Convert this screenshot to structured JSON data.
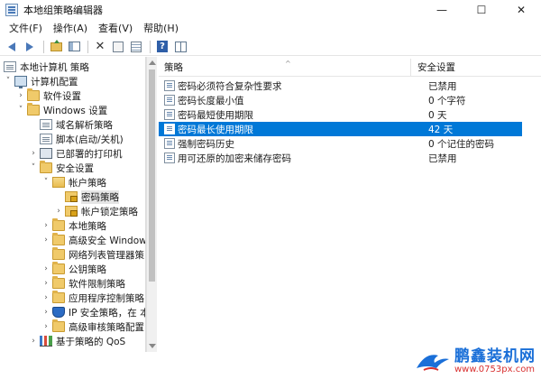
{
  "window": {
    "title": "本地组策略编辑器",
    "controls": {
      "minimize": "—",
      "maximize": "☐",
      "close": "✕"
    }
  },
  "menu": [
    "文件(F)",
    "操作(A)",
    "查看(V)",
    "帮助(H)"
  ],
  "toolbar": {
    "icons": [
      "back-icon",
      "forward-icon",
      "up-folder-icon",
      "show-tree-icon",
      "delete-icon",
      "properties-icon",
      "export-list-icon",
      "help-icon",
      "view-icon"
    ]
  },
  "tree": {
    "items": [
      {
        "label": "本地计算机 策略",
        "icon": "computer-policy-icon"
      },
      {
        "label": "计算机配置",
        "icon": "computer-icon"
      },
      {
        "label": "软件设置",
        "icon": "folder-icon"
      },
      {
        "label": "Windows 设置",
        "icon": "folder-icon"
      },
      {
        "label": "域名解析策略",
        "icon": "document-icon"
      },
      {
        "label": "脚本(启动/关机)",
        "icon": "document-icon"
      },
      {
        "label": "已部署的打印机",
        "icon": "printer-icon"
      },
      {
        "label": "安全设置",
        "icon": "folder-icon"
      },
      {
        "label": "帐户策略",
        "icon": "folder-open-icon"
      },
      {
        "label": "密码策略",
        "icon": "lock-folder-icon"
      },
      {
        "label": "帐户锁定策略",
        "icon": "lock-folder-icon"
      },
      {
        "label": "本地策略",
        "icon": "folder-icon"
      },
      {
        "label": "高级安全 Window",
        "icon": "folder-icon"
      },
      {
        "label": "网络列表管理器策",
        "icon": "folder-icon"
      },
      {
        "label": "公钥策略",
        "icon": "folder-icon"
      },
      {
        "label": "软件限制策略",
        "icon": "folder-icon"
      },
      {
        "label": "应用程序控制策略",
        "icon": "folder-icon"
      },
      {
        "label": "IP 安全策略，在 本",
        "icon": "shield-icon"
      },
      {
        "label": "高级审核策略配置",
        "icon": "folder-icon"
      },
      {
        "label": "基于策略的 QoS",
        "icon": "chart-icon"
      }
    ]
  },
  "list": {
    "columns": [
      "策略",
      "安全设置"
    ],
    "rows": [
      {
        "policy": "密码必须符合复杂性要求",
        "setting": "已禁用"
      },
      {
        "policy": "密码长度最小值",
        "setting": "0 个字符"
      },
      {
        "policy": "密码最短使用期限",
        "setting": "0 天"
      },
      {
        "policy": "密码最长使用期限",
        "setting": "42 天"
      },
      {
        "policy": "强制密码历史",
        "setting": "0 个记住的密码"
      },
      {
        "policy": "用可还原的加密来储存密码",
        "setting": "已禁用"
      }
    ],
    "selected_row": 3
  },
  "watermark": {
    "brand": "鹏鑫装机网",
    "url": "www.0753px.com"
  },
  "colors": {
    "selection": "#0078d7",
    "brand": "#1a6fd8",
    "url": "#d83030"
  }
}
